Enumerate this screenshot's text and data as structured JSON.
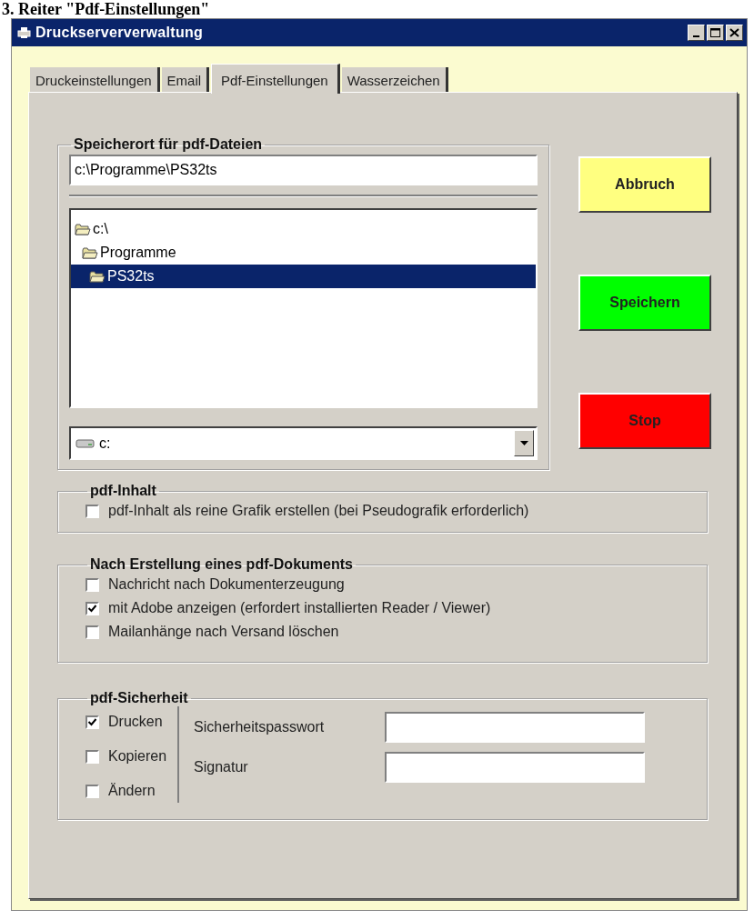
{
  "heading": "3. Reiter \"Pdf-Einstellungen\"",
  "window": {
    "title": "Druckserververwaltung"
  },
  "tabs": [
    {
      "label": "Druckeinstellungen",
      "selected": false
    },
    {
      "label": "Email",
      "selected": false
    },
    {
      "label": "Pdf-Einstellungen",
      "selected": true
    },
    {
      "label": "Wasserzeichen",
      "selected": false
    }
  ],
  "storage": {
    "title": "Speicherort für pdf-Dateien",
    "path": "c:\\Programme\\PS32ts",
    "folders": [
      {
        "label": "c:\\",
        "selected": false,
        "children": [
          {
            "label": "Programme",
            "selected": false,
            "children": [
              {
                "label": "PS32ts",
                "selected": true
              }
            ]
          }
        ]
      }
    ],
    "drive": "c:"
  },
  "buttons": [
    {
      "label": "Abbruch",
      "color": "#ffff80"
    },
    {
      "label": "Speichern",
      "color": "#00ff00"
    },
    {
      "label": "Stop",
      "color": "#ff0000"
    }
  ],
  "content_group": {
    "title": "pdf-Inhalt",
    "options": [
      {
        "label": "pdf-Inhalt als reine Grafik erstellen (bei Pseudografik erforderlich)",
        "checked": false
      }
    ]
  },
  "after_group": {
    "title": "Nach Erstellung eines pdf-Dokuments",
    "options": [
      {
        "label": "Nachricht nach Dokumenterzeugung",
        "checked": false
      },
      {
        "label": "mit Adobe anzeigen (erfordert installierten Reader / Viewer)",
        "checked": true
      },
      {
        "label": "Mailanhänge nach Versand löschen",
        "checked": false
      }
    ]
  },
  "security_group": {
    "title": "pdf-Sicherheit",
    "options": [
      {
        "label": "Drucken",
        "checked": true
      },
      {
        "label": "Kopieren",
        "checked": false
      },
      {
        "label": "Ändern",
        "checked": false
      }
    ],
    "fields": [
      {
        "label": "Sicherheitspasswort"
      },
      {
        "label": "Signatur"
      }
    ]
  }
}
